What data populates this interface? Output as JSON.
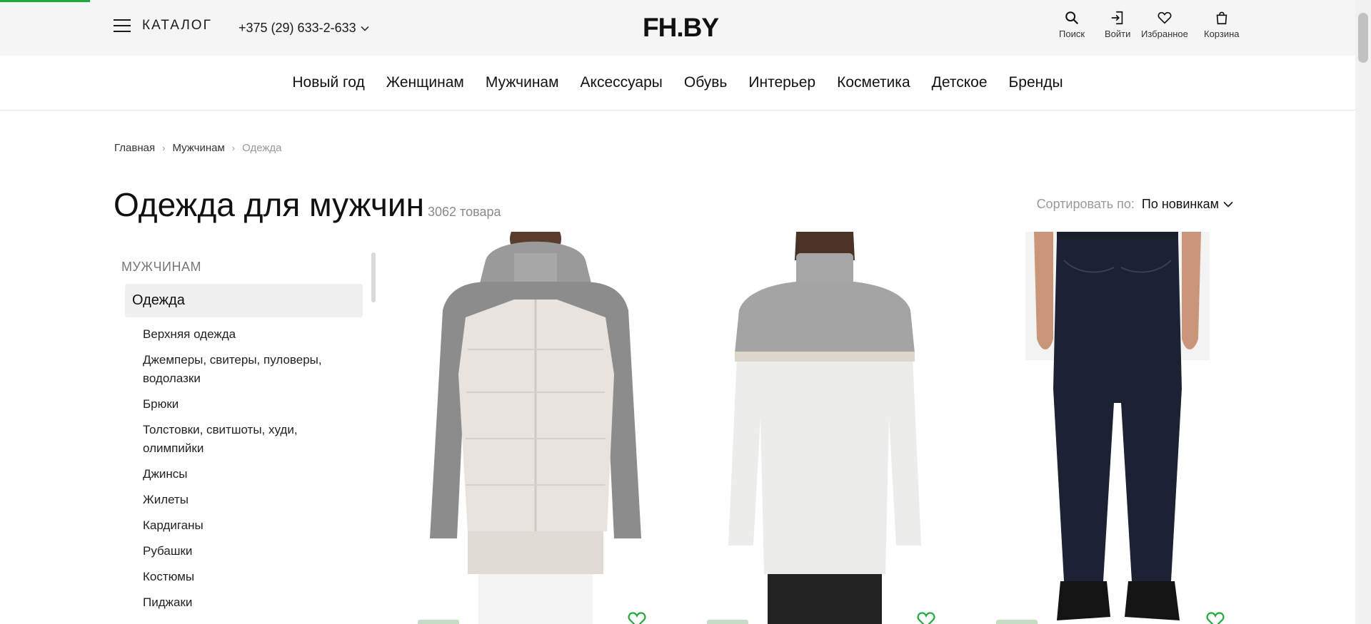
{
  "header": {
    "catalog_label": "Каталог",
    "phone": "+375 (29) 633-2-633",
    "logo": "FH.BY",
    "icons": [
      {
        "name": "search",
        "label": "Поиск"
      },
      {
        "name": "login",
        "label": "Войти"
      },
      {
        "name": "favorites",
        "label": "Избранное"
      },
      {
        "name": "cart",
        "label": "Корзина"
      }
    ]
  },
  "nav": {
    "items": [
      "Новый год",
      "Женщинам",
      "Мужчинам",
      "Аксессуары",
      "Обувь",
      "Интерьер",
      "Косметика",
      "Детское",
      "Бренды"
    ]
  },
  "breadcrumb": {
    "items": [
      "Главная",
      "Мужчинам",
      "Одежда"
    ]
  },
  "page": {
    "title": "Одежда для мужчин",
    "count": "3062 товара"
  },
  "sort": {
    "label": "Сортировать по:",
    "value": "По новинкам"
  },
  "sidebar": {
    "section": "МУЖЧИНАМ",
    "active": "Одежда",
    "items": [
      "Верхняя одежда",
      "Джемперы, свитеры, пуловеры, водолазки",
      "Брюки",
      "Толстовки, свитшоты, худи, олимпийки",
      "Джинсы",
      "Жилеты",
      "Кардиганы",
      "Рубашки",
      "Костюмы",
      "Пиджаки"
    ]
  },
  "colors": {
    "accent": "#1faa3a",
    "header_bg": "#f5f5f5",
    "active_bg": "#f0f0f0",
    "muted_text": "#999999"
  }
}
